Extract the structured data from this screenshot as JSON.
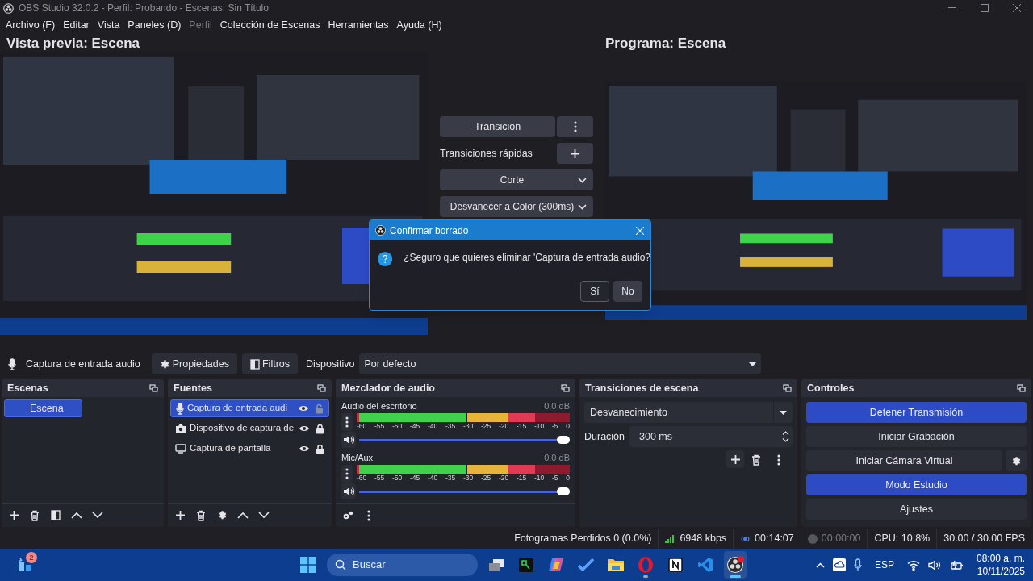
{
  "window": {
    "title": "OBS Studio 32.0.2 - Perfil: Probando - Escenas: Sin Título"
  },
  "menu": [
    {
      "label": "Archivo (F)",
      "disabled": false
    },
    {
      "label": "Editar",
      "disabled": false
    },
    {
      "label": "Vista",
      "disabled": false
    },
    {
      "label": "Paneles (D)",
      "disabled": false
    },
    {
      "label": "Perfil",
      "disabled": true
    },
    {
      "label": "Colección de Escenas",
      "disabled": false
    },
    {
      "label": "Herramientas",
      "disabled": false
    },
    {
      "label": "Ayuda (H)",
      "disabled": false
    }
  ],
  "preview": {
    "title": "Vista previa: Escena",
    "kind": "picture"
  },
  "program": {
    "title": "Programa: Escena",
    "kind": "picture"
  },
  "transition_panel": {
    "transition_button": "Transición",
    "quick_label": "Transiciones rápidas",
    "quick_transitions": [
      "Corte",
      "Desvanecer a Color (300ms)"
    ]
  },
  "dialog": {
    "title": "Confirmar borrado",
    "message": "¿Seguro que quieres eliminar 'Captura de entrada audio?",
    "buttons": [
      {
        "label": "Sí",
        "focused": true
      },
      {
        "label": "No",
        "focused": false
      }
    ]
  },
  "source_toolbar": {
    "source": "Captura de entrada audio",
    "buttons": [
      {
        "kind": "properties",
        "label": "Propiedades"
      },
      {
        "kind": "filters",
        "label": "Filtros"
      }
    ],
    "device_label": "Dispositivo",
    "device": "Por defecto"
  },
  "scenes": {
    "title": "Escenas",
    "items": [
      {
        "label": "Escena",
        "selected": true
      }
    ]
  },
  "sources": {
    "title": "Fuentes",
    "items": [
      {
        "kind": "mic",
        "label": "Captura de entrada audi",
        "selected": true,
        "visible": true,
        "locked": false
      },
      {
        "kind": "camera",
        "label": "Dispositivo de captura de",
        "selected": false,
        "visible": true,
        "locked": true
      },
      {
        "kind": "display",
        "label": "Captura de pantalla",
        "selected": false,
        "visible": true,
        "locked": true
      }
    ]
  },
  "mixer": {
    "title": "Mezclador de audio",
    "channels": [
      {
        "name": "Audio del escritorio",
        "reading": "0.0 dB",
        "muted": false,
        "level": 1,
        "scale": [
          "-60",
          "-55",
          "-50",
          "-45",
          "-40",
          "-35",
          "-30",
          "-25",
          "-20",
          "-15",
          "-10",
          "-5",
          "0"
        ]
      },
      {
        "name": "Mic/Aux",
        "reading": "0.0 dB",
        "muted": false,
        "level": 1,
        "scale": [
          "-60",
          "-55",
          "-50",
          "-45",
          "-40",
          "-35",
          "-30",
          "-25",
          "-20",
          "-15",
          "-10",
          "-5",
          "0"
        ]
      }
    ]
  },
  "transitions": {
    "title": "Transiciones de escena",
    "transition": "Desvanecimiento",
    "duration_label": "Duración",
    "duration": "300 ms"
  },
  "controls": {
    "title": "Controles",
    "buttons": [
      {
        "label": "Detener Transmisión",
        "active": true,
        "settings": false
      },
      {
        "label": "Iniciar Grabación",
        "active": false,
        "settings": false
      },
      {
        "label": "Iniciar Cámara Virtual",
        "active": false,
        "settings": true
      },
      {
        "label": "Modo Estudio",
        "active": true,
        "settings": false
      },
      {
        "label": "Ajustes",
        "active": false,
        "settings": false
      }
    ]
  },
  "status_bar": {
    "dropped_frames": "Fotogramas Perdidos 0 (0.0%)",
    "bitrate": "6948 kbps",
    "stream_time": "00:14:07",
    "record_time": "00:00:00",
    "cpu": "CPU: 10.8%",
    "fps": "30.00 / 30.00 FPS"
  },
  "taskbar": {
    "widgets_badge": "2",
    "search_placeholder": "Buscar",
    "apps": [
      {
        "kind": "taskview",
        "running": false,
        "active": false
      },
      {
        "kind": "terminal",
        "running": false,
        "active": false
      },
      {
        "kind": "copilot",
        "running": false,
        "active": false
      },
      {
        "kind": "todo",
        "running": false,
        "active": false
      },
      {
        "kind": "folder",
        "running": false,
        "active": false
      },
      {
        "kind": "opera",
        "running": true,
        "active": false
      },
      {
        "kind": "notion",
        "running": false,
        "active": false
      },
      {
        "kind": "vscode",
        "running": false,
        "active": false
      },
      {
        "kind": "obs",
        "running": true,
        "active": true
      }
    ],
    "language": "ESP",
    "time": "08:00 a. m.",
    "date": "10/11/2025"
  }
}
